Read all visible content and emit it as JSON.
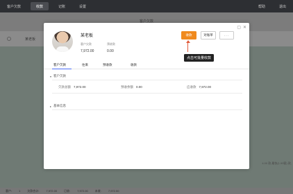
{
  "app": {
    "tabs": [
      "客户欠款",
      "收款",
      "记账",
      "设置"
    ],
    "active_tab_index": 1,
    "right_items": [
      "帮助",
      "退出"
    ],
    "page_title": "客户欠款",
    "row_label": "某老板",
    "right_text": "4.00 款,最快(1.99客) 款,",
    "status_bar": [
      "客户:",
      "1",
      "欠款合计:",
      "7,972.00",
      "已收:",
      "7,972.00",
      "未收:",
      "7,972.00"
    ]
  },
  "modal": {
    "window_controls": {
      "maximize": "▢",
      "close": "✕"
    },
    "customer_name": "某老板",
    "stats": [
      {
        "label": "客户欠款",
        "value": "7,972.00"
      },
      {
        "label": "预收款",
        "value": "0.00"
      }
    ],
    "buttons": {
      "primary": "收款",
      "secondary": "对账单",
      "more": "···"
    },
    "tooltip": "点击可批量收款",
    "tabs": [
      "客户欠款",
      "往来",
      "预收款",
      "收款"
    ],
    "sections": {
      "debt": {
        "title": "客户欠款",
        "fields": [
          {
            "label": "欠款总额",
            "value": "7,972.00"
          },
          {
            "label": "预收余额",
            "value": "0.00"
          },
          {
            "label": "应收款",
            "value": "7,972.00"
          }
        ]
      },
      "basic": {
        "title": "基本信息"
      }
    }
  },
  "colors": {
    "primary_button": "#f08a1e",
    "tab_underline": "#4a6cf7",
    "annotation_arrow": "#e05a3a",
    "tooltip_bg": "#222222"
  }
}
